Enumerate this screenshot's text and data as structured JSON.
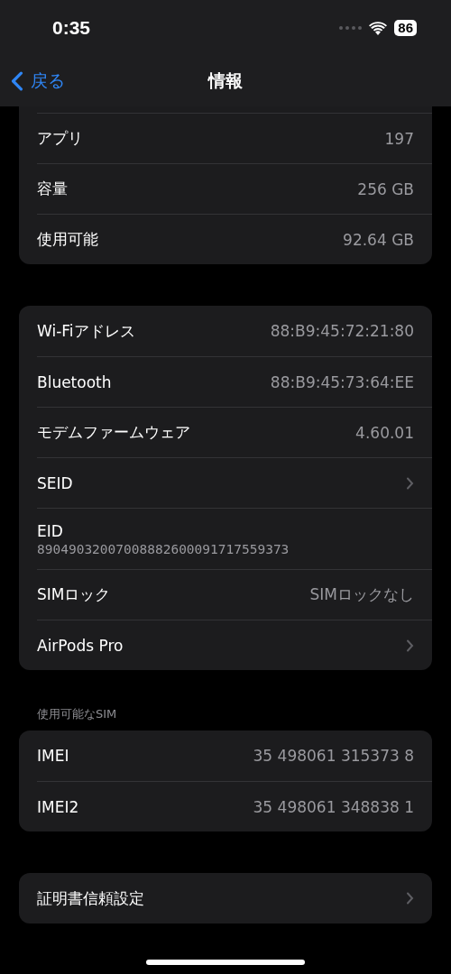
{
  "status_bar": {
    "time": "0:35",
    "battery": "86"
  },
  "nav": {
    "back": "戻る",
    "title": "情報"
  },
  "groups": [
    {
      "cut_top": true,
      "rows": [
        {
          "kind": "value",
          "label": "アプリ",
          "value": "197"
        },
        {
          "kind": "value",
          "label": "容量",
          "value": "256 GB"
        },
        {
          "kind": "value",
          "label": "使用可能",
          "value": "92.64 GB"
        }
      ]
    },
    {
      "rows": [
        {
          "kind": "value",
          "label": "Wi-Fiアドレス",
          "value": "88:B9:45:72:21:80"
        },
        {
          "kind": "value",
          "label": "Bluetooth",
          "value": "88:B9:45:73:64:EE"
        },
        {
          "kind": "value",
          "label": "モデムファームウェア",
          "value": "4.60.01"
        },
        {
          "kind": "chevron",
          "label": "SEID"
        },
        {
          "kind": "stacked",
          "label": "EID",
          "value": "89049032007008882600091717559373"
        },
        {
          "kind": "value",
          "label": "SIMロック",
          "value": "SIMロックなし"
        },
        {
          "kind": "chevron",
          "label": "AirPods Pro"
        }
      ]
    },
    {
      "header": "使用可能なSIM",
      "rows": [
        {
          "kind": "value",
          "label": "IMEI",
          "value": "35 498061 315373 8"
        },
        {
          "kind": "value",
          "label": "IMEI2",
          "value": "35 498061 348838 1"
        }
      ]
    },
    {
      "rows": [
        {
          "kind": "chevron",
          "label": "証明書信頼設定"
        }
      ]
    }
  ]
}
